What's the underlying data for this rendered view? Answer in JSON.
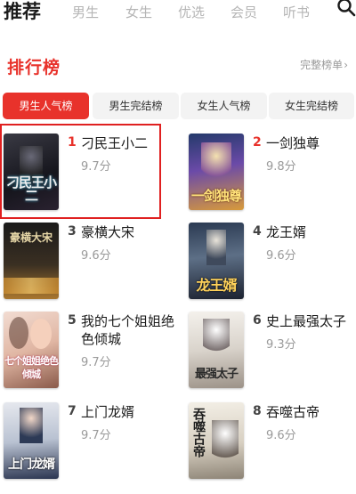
{
  "nav": {
    "tabs": [
      {
        "label": "推荐",
        "active": true
      },
      {
        "label": "男生",
        "active": false
      },
      {
        "label": "女生",
        "active": false
      },
      {
        "label": "优选",
        "active": false
      },
      {
        "label": "会员",
        "active": false
      },
      {
        "label": "听书",
        "active": false
      }
    ],
    "search_icon": "search-icon"
  },
  "ranking": {
    "title": "排行榜",
    "full_link": "完整榜单",
    "accent_color": "#e8322b",
    "tabs": [
      {
        "label": "男生人气榜",
        "active": true
      },
      {
        "label": "男生完结榜",
        "active": false
      },
      {
        "label": "女生人气榜",
        "active": false
      },
      {
        "label": "女生完结榜",
        "active": false
      }
    ],
    "books": [
      {
        "rank": "1",
        "title": "刁民王小二",
        "score": "9.7分",
        "cover_text": "刁民王小二"
      },
      {
        "rank": "2",
        "title": "一剑独尊",
        "score": "9.8分",
        "cover_text": "一剑独尊"
      },
      {
        "rank": "3",
        "title": "豪横大宋",
        "score": "9.6分",
        "cover_text": "豪横大宋"
      },
      {
        "rank": "4",
        "title": "龙王婿",
        "score": "9.6分",
        "cover_text": "龙王婿"
      },
      {
        "rank": "5",
        "title": "我的七个姐姐绝色倾城",
        "score": "9.7分",
        "cover_text": "七个姐姐绝色倾城"
      },
      {
        "rank": "6",
        "title": "史上最强太子",
        "score": "9.3分",
        "cover_text": "最强太子"
      },
      {
        "rank": "7",
        "title": "上门龙婿",
        "score": "9.7分",
        "cover_text": "上门龙婿"
      },
      {
        "rank": "8",
        "title": "吞噬古帝",
        "score": "9.6分",
        "cover_text": "吞噬古帝"
      }
    ]
  }
}
